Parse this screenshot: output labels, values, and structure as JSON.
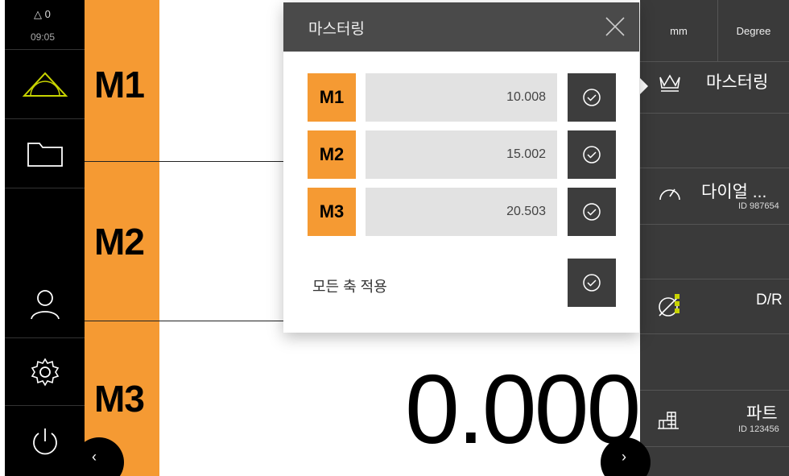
{
  "status": {
    "warning_count": "0",
    "time": "09:05"
  },
  "strip": {
    "labels": [
      "M1",
      "M2",
      "M3"
    ]
  },
  "main": {
    "value": "0.000"
  },
  "dialog": {
    "title": "마스터링",
    "rows": [
      {
        "tag": "M1",
        "value": "10.008"
      },
      {
        "tag": "M2",
        "value": "15.002"
      },
      {
        "tag": "M3",
        "value": "20.503"
      }
    ],
    "apply_all_label": "모든 축 적용"
  },
  "right": {
    "units": [
      "mm",
      "Degree"
    ],
    "mastering_label": "마스터링",
    "dial_label": "다이얼 ...",
    "dial_id": "ID 987654",
    "dr_label": "D/R",
    "part_label": "파트",
    "part_id": "ID 123456"
  },
  "colors": {
    "accent": "#f59a33",
    "panel": "#3a3a3a",
    "status_green": "#c8d400"
  }
}
